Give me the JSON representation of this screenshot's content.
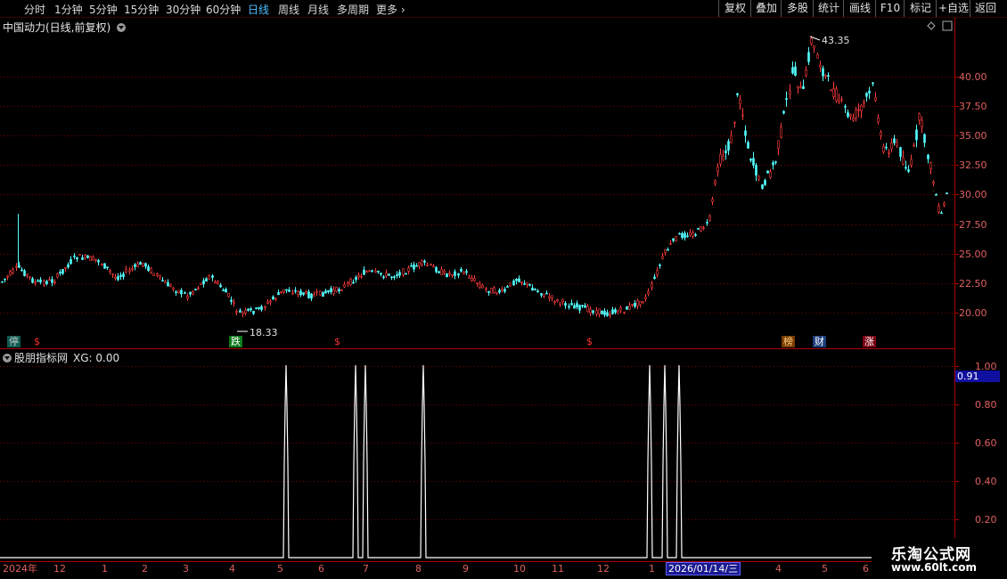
{
  "toolbar": {
    "periods": [
      "分时",
      "1分钟",
      "5分钟",
      "15分钟",
      "30分钟",
      "60分钟",
      "日线",
      "周线",
      "月线",
      "多周期",
      "更多"
    ],
    "active_period": "日线",
    "more_icon": "chevron-right-icon",
    "right_buttons": [
      "复权",
      "叠加",
      "多股",
      "统计",
      "画线",
      "F10",
      "标记",
      "+自选",
      "返回"
    ]
  },
  "main_chart": {
    "title": "中国动力(日线,前复权)",
    "y_ticks": [
      "40.00",
      "37.50",
      "35.00",
      "32.50",
      "30.00",
      "27.50",
      "25.00",
      "22.50",
      "20.00"
    ],
    "high_label": "43.35",
    "low_label": "18.33",
    "badges": [
      {
        "text": "停",
        "color": "#2ec4b6"
      },
      {
        "text": "$",
        "color": "#ff3030"
      },
      {
        "text": "跌",
        "color": "#ffffff"
      },
      {
        "text": "$",
        "color": "#ff3030"
      },
      {
        "text": "$",
        "color": "#ff3030"
      },
      {
        "text": "榜",
        "color": "#ffb060"
      },
      {
        "text": "财",
        "color": "#ffffff"
      },
      {
        "text": "涨",
        "color": "#ffffff"
      }
    ],
    "colors": {
      "up": "#ff3c3c",
      "down": "#54ffff",
      "grid": "#7a0000",
      "axis": "#b00000"
    }
  },
  "indicator": {
    "name": "股朋指标网",
    "xg_label": "XG: 0.00",
    "y_ticks": [
      "1.00",
      "0.80",
      "0.60",
      "0.40",
      "0.20"
    ],
    "current_value": "0.91"
  },
  "x_axis": {
    "labels": [
      "2024年",
      "12",
      "1",
      "2",
      "3",
      "4",
      "5",
      "6",
      "7",
      "8",
      "9",
      "10",
      "11",
      "12",
      "1",
      "2026/01/14/三",
      "4",
      "5",
      "6"
    ]
  },
  "watermark": {
    "line1": "乐淘公式网",
    "line2": "www.60lt.com"
  }
}
